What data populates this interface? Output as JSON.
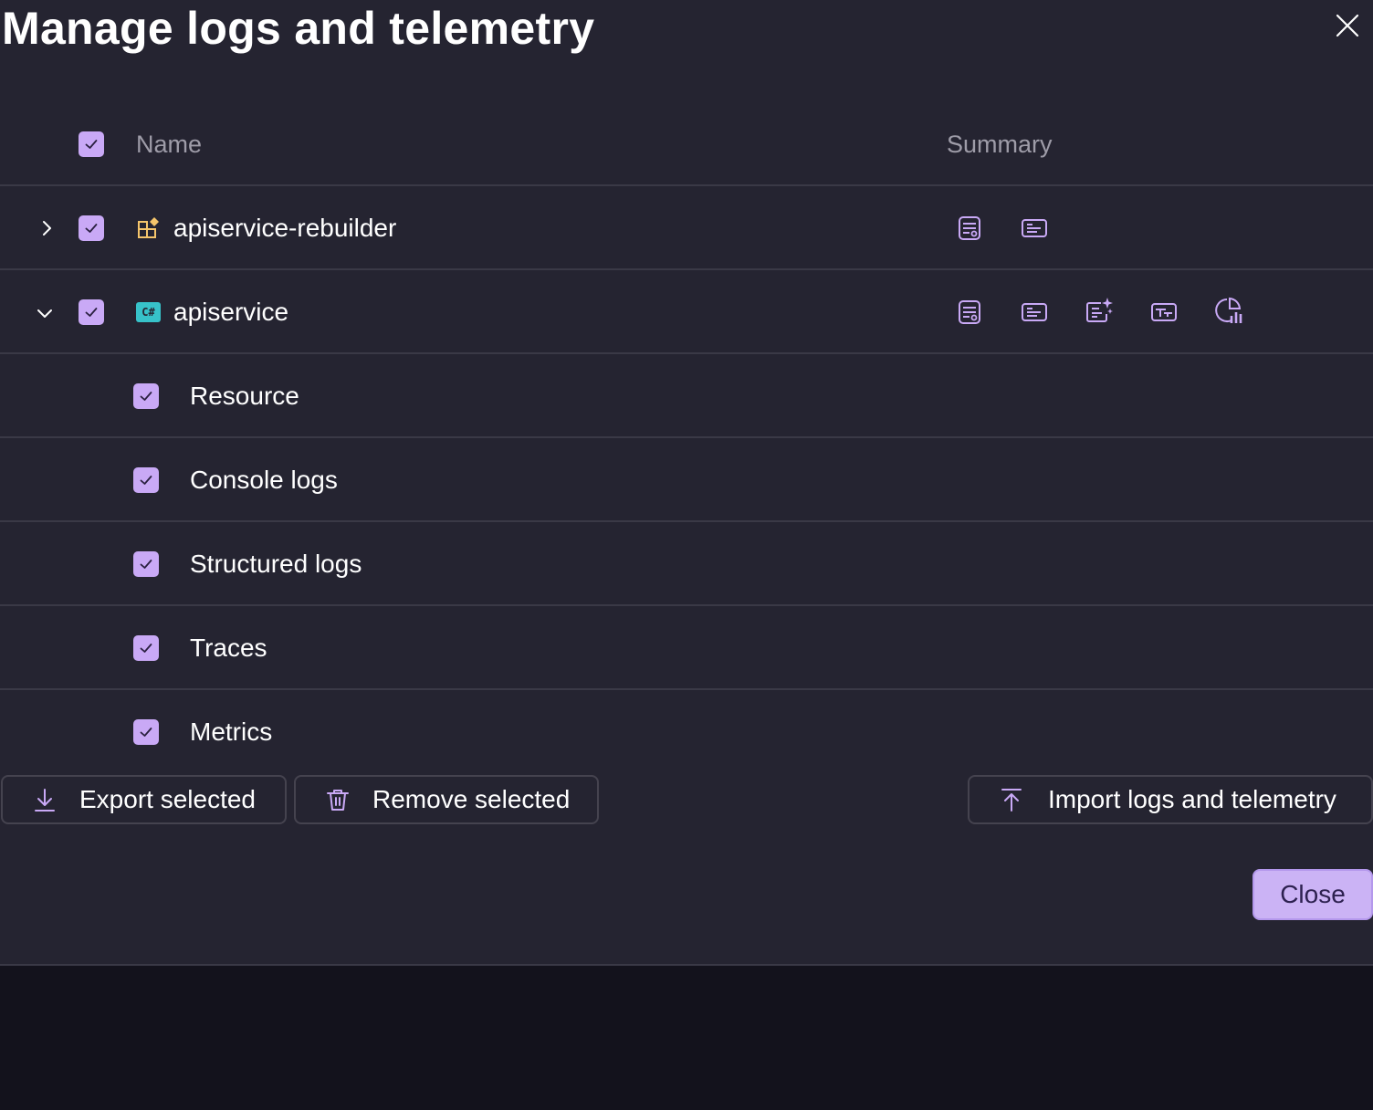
{
  "dialog": {
    "title": "Manage logs and telemetry",
    "close_icon": "close-icon"
  },
  "table": {
    "headers": {
      "name": "Name",
      "summary": "Summary"
    },
    "rows": [
      {
        "label": "apiservice-rebuilder",
        "expanded": false,
        "checked": true,
        "icon": "project-icon",
        "summary_icons": [
          "resource-icon",
          "console-logs-icon"
        ]
      },
      {
        "label": "apiservice",
        "expanded": true,
        "checked": true,
        "icon": "csharp-icon",
        "icon_text": "C#",
        "summary_icons": [
          "resource-icon",
          "console-logs-icon",
          "structured-logs-icon",
          "traces-icon",
          "metrics-icon"
        ]
      }
    ],
    "children": [
      {
        "label": "Resource",
        "checked": true
      },
      {
        "label": "Console logs",
        "checked": true
      },
      {
        "label": "Structured logs",
        "checked": true
      },
      {
        "label": "Traces",
        "checked": true
      },
      {
        "label": "Metrics",
        "checked": true
      }
    ]
  },
  "actions": {
    "export": "Export selected",
    "remove": "Remove selected",
    "import": "Import logs and telemetry",
    "close": "Close"
  },
  "colors": {
    "dialog_bg": "#252431",
    "page_bg": "#13121c",
    "checkbox": "#c9a9f6",
    "accent": "#cbb3f5",
    "icon_stroke": "#c9a9f6",
    "project_icon": "#f5c56b",
    "csharp_icon": "#37c2c9"
  }
}
